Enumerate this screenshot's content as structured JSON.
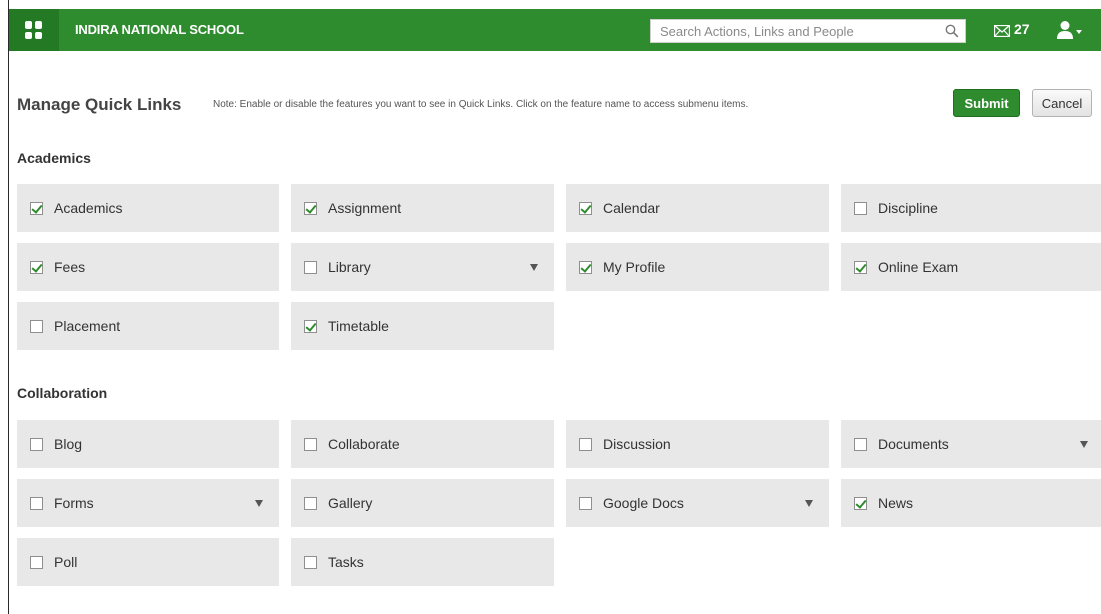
{
  "topbar": {
    "school_name": "INDIRA NATIONAL SCHOOL",
    "search_placeholder": "Search Actions, Links and People",
    "mail_count": "27",
    "brand_color": "#2e8b2e"
  },
  "header": {
    "title": "Manage Quick Links",
    "note": "Note: Enable or disable the features you want to see in Quick Links. Click on the feature name to access submenu items.",
    "submit_label": "Submit",
    "cancel_label": "Cancel"
  },
  "sections": [
    {
      "title": "Academics",
      "items": [
        {
          "label": "Academics",
          "checked": true,
          "has_submenu": false
        },
        {
          "label": "Assignment",
          "checked": true,
          "has_submenu": false
        },
        {
          "label": "Calendar",
          "checked": true,
          "has_submenu": false
        },
        {
          "label": "Discipline",
          "checked": false,
          "has_submenu": false
        },
        {
          "label": "Fees",
          "checked": true,
          "has_submenu": false
        },
        {
          "label": "Library",
          "checked": false,
          "has_submenu": true
        },
        {
          "label": "My Profile",
          "checked": true,
          "has_submenu": false
        },
        {
          "label": "Online Exam",
          "checked": true,
          "has_submenu": false
        },
        {
          "label": "Placement",
          "checked": false,
          "has_submenu": false
        },
        {
          "label": "Timetable",
          "checked": true,
          "has_submenu": false
        }
      ]
    },
    {
      "title": "Collaboration",
      "items": [
        {
          "label": "Blog",
          "checked": false,
          "has_submenu": false
        },
        {
          "label": "Collaborate",
          "checked": false,
          "has_submenu": false
        },
        {
          "label": "Discussion",
          "checked": false,
          "has_submenu": false
        },
        {
          "label": "Documents",
          "checked": false,
          "has_submenu": true
        },
        {
          "label": "Forms",
          "checked": false,
          "has_submenu": true
        },
        {
          "label": "Gallery",
          "checked": false,
          "has_submenu": false
        },
        {
          "label": "Google Docs",
          "checked": false,
          "has_submenu": true
        },
        {
          "label": "News",
          "checked": true,
          "has_submenu": false
        },
        {
          "label": "Poll",
          "checked": false,
          "has_submenu": false
        },
        {
          "label": "Tasks",
          "checked": false,
          "has_submenu": false
        }
      ]
    }
  ]
}
